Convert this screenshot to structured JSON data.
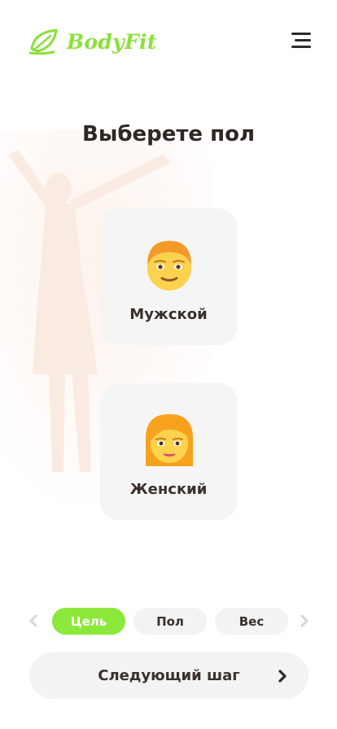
{
  "header": {
    "logo_text": "BodyFit",
    "brand_color": "#8be03a",
    "menu_icon": "hamburger-menu-icon"
  },
  "page": {
    "title": "Выберете пол"
  },
  "options": [
    {
      "label": "Мужской",
      "icon": "man-emoji-icon"
    },
    {
      "label": "Женский",
      "icon": "woman-emoji-icon"
    }
  ],
  "steps": {
    "prev_icon": "chevron-left-icon",
    "next_icon": "chevron-right-icon",
    "items": [
      {
        "label": "Цель",
        "active": true
      },
      {
        "label": "Пол",
        "active": false
      },
      {
        "label": "Вес",
        "active": false
      }
    ],
    "active_color": "#8ce83a"
  },
  "footer": {
    "next_label": "Следующий шаг",
    "next_icon": "chevron-right-icon"
  }
}
